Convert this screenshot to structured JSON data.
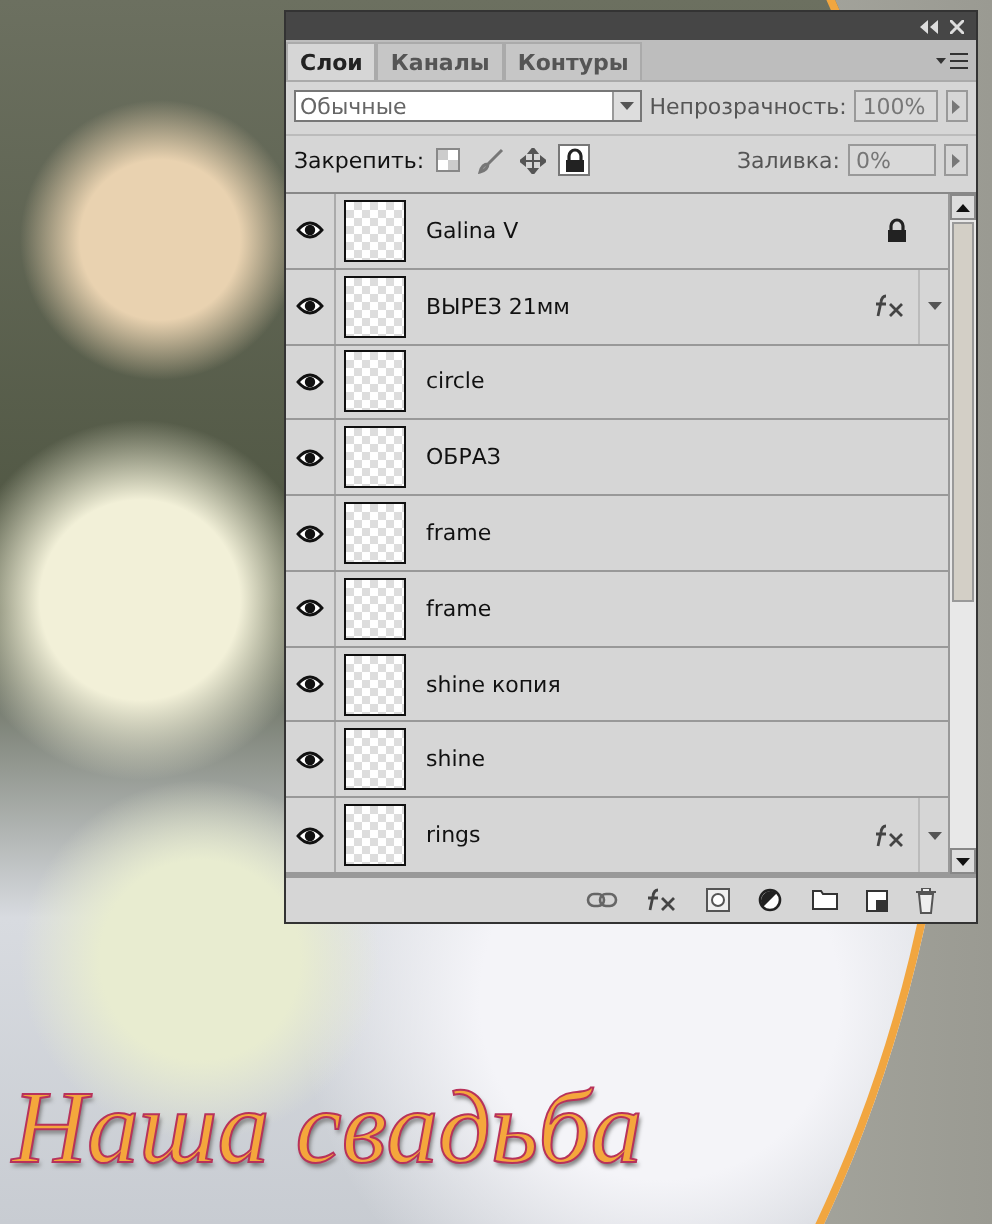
{
  "canvas": {
    "caption": "Наша свадьба"
  },
  "panel": {
    "tabs": [
      {
        "label": "Слои",
        "selected": true
      },
      {
        "label": "Каналы",
        "selected": false
      },
      {
        "label": "Контуры",
        "selected": false
      }
    ],
    "blend_mode": "Обычные",
    "opacity_label": "Непрозрачность:",
    "opacity": "100%",
    "lock_label": "Закрепить:",
    "locks": [
      {
        "kind": "transparency",
        "on": false
      },
      {
        "kind": "pixels",
        "on": false
      },
      {
        "kind": "position",
        "on": false
      },
      {
        "kind": "all",
        "on": true
      }
    ],
    "fill_label": "Заливка:",
    "fill": "0%",
    "layers": [
      {
        "name": "Galina V",
        "visible": true,
        "locked": true,
        "effects": false
      },
      {
        "name": "ВЫРЕЗ 21мм",
        "visible": true,
        "locked": false,
        "effects": true
      },
      {
        "name": "circle",
        "visible": true,
        "locked": false,
        "effects": false
      },
      {
        "name": "ОБРАЗ",
        "visible": true,
        "locked": false,
        "effects": false
      },
      {
        "name": "frame",
        "visible": true,
        "locked": false,
        "effects": false
      },
      {
        "name": "frame",
        "visible": true,
        "locked": false,
        "effects": false
      },
      {
        "name": "shine копия",
        "visible": true,
        "locked": false,
        "effects": false
      },
      {
        "name": "shine",
        "visible": true,
        "locked": false,
        "effects": false
      },
      {
        "name": "rings",
        "visible": true,
        "locked": false,
        "effects": true
      }
    ]
  }
}
